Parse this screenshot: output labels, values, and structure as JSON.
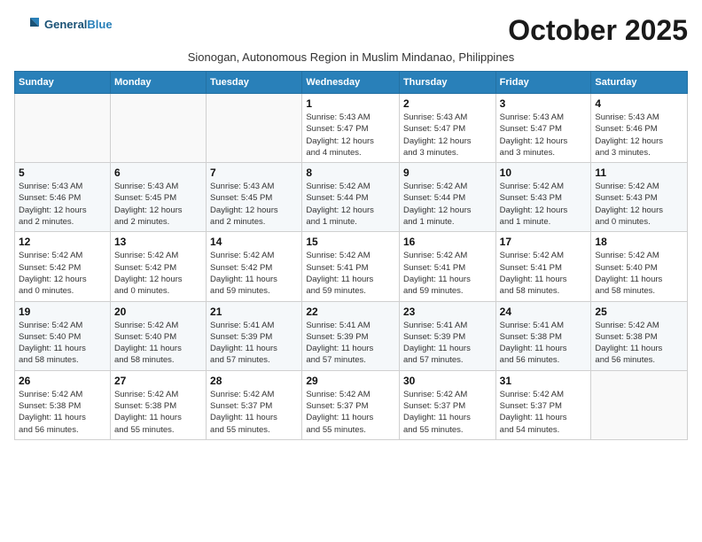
{
  "header": {
    "logo_line1": "General",
    "logo_line2": "Blue",
    "month_title": "October 2025",
    "subtitle": "Sionogan, Autonomous Region in Muslim Mindanao, Philippines"
  },
  "days_of_week": [
    "Sunday",
    "Monday",
    "Tuesday",
    "Wednesday",
    "Thursday",
    "Friday",
    "Saturday"
  ],
  "weeks": [
    [
      {
        "day": "",
        "info": ""
      },
      {
        "day": "",
        "info": ""
      },
      {
        "day": "",
        "info": ""
      },
      {
        "day": "1",
        "info": "Sunrise: 5:43 AM\nSunset: 5:47 PM\nDaylight: 12 hours\nand 4 minutes."
      },
      {
        "day": "2",
        "info": "Sunrise: 5:43 AM\nSunset: 5:47 PM\nDaylight: 12 hours\nand 3 minutes."
      },
      {
        "day": "3",
        "info": "Sunrise: 5:43 AM\nSunset: 5:47 PM\nDaylight: 12 hours\nand 3 minutes."
      },
      {
        "day": "4",
        "info": "Sunrise: 5:43 AM\nSunset: 5:46 PM\nDaylight: 12 hours\nand 3 minutes."
      }
    ],
    [
      {
        "day": "5",
        "info": "Sunrise: 5:43 AM\nSunset: 5:46 PM\nDaylight: 12 hours\nand 2 minutes."
      },
      {
        "day": "6",
        "info": "Sunrise: 5:43 AM\nSunset: 5:45 PM\nDaylight: 12 hours\nand 2 minutes."
      },
      {
        "day": "7",
        "info": "Sunrise: 5:43 AM\nSunset: 5:45 PM\nDaylight: 12 hours\nand 2 minutes."
      },
      {
        "day": "8",
        "info": "Sunrise: 5:42 AM\nSunset: 5:44 PM\nDaylight: 12 hours\nand 1 minute."
      },
      {
        "day": "9",
        "info": "Sunrise: 5:42 AM\nSunset: 5:44 PM\nDaylight: 12 hours\nand 1 minute."
      },
      {
        "day": "10",
        "info": "Sunrise: 5:42 AM\nSunset: 5:43 PM\nDaylight: 12 hours\nand 1 minute."
      },
      {
        "day": "11",
        "info": "Sunrise: 5:42 AM\nSunset: 5:43 PM\nDaylight: 12 hours\nand 0 minutes."
      }
    ],
    [
      {
        "day": "12",
        "info": "Sunrise: 5:42 AM\nSunset: 5:42 PM\nDaylight: 12 hours\nand 0 minutes."
      },
      {
        "day": "13",
        "info": "Sunrise: 5:42 AM\nSunset: 5:42 PM\nDaylight: 12 hours\nand 0 minutes."
      },
      {
        "day": "14",
        "info": "Sunrise: 5:42 AM\nSunset: 5:42 PM\nDaylight: 11 hours\nand 59 minutes."
      },
      {
        "day": "15",
        "info": "Sunrise: 5:42 AM\nSunset: 5:41 PM\nDaylight: 11 hours\nand 59 minutes."
      },
      {
        "day": "16",
        "info": "Sunrise: 5:42 AM\nSunset: 5:41 PM\nDaylight: 11 hours\nand 59 minutes."
      },
      {
        "day": "17",
        "info": "Sunrise: 5:42 AM\nSunset: 5:41 PM\nDaylight: 11 hours\nand 58 minutes."
      },
      {
        "day": "18",
        "info": "Sunrise: 5:42 AM\nSunset: 5:40 PM\nDaylight: 11 hours\nand 58 minutes."
      }
    ],
    [
      {
        "day": "19",
        "info": "Sunrise: 5:42 AM\nSunset: 5:40 PM\nDaylight: 11 hours\nand 58 minutes."
      },
      {
        "day": "20",
        "info": "Sunrise: 5:42 AM\nSunset: 5:40 PM\nDaylight: 11 hours\nand 58 minutes."
      },
      {
        "day": "21",
        "info": "Sunrise: 5:41 AM\nSunset: 5:39 PM\nDaylight: 11 hours\nand 57 minutes."
      },
      {
        "day": "22",
        "info": "Sunrise: 5:41 AM\nSunset: 5:39 PM\nDaylight: 11 hours\nand 57 minutes."
      },
      {
        "day": "23",
        "info": "Sunrise: 5:41 AM\nSunset: 5:39 PM\nDaylight: 11 hours\nand 57 minutes."
      },
      {
        "day": "24",
        "info": "Sunrise: 5:41 AM\nSunset: 5:38 PM\nDaylight: 11 hours\nand 56 minutes."
      },
      {
        "day": "25",
        "info": "Sunrise: 5:42 AM\nSunset: 5:38 PM\nDaylight: 11 hours\nand 56 minutes."
      }
    ],
    [
      {
        "day": "26",
        "info": "Sunrise: 5:42 AM\nSunset: 5:38 PM\nDaylight: 11 hours\nand 56 minutes."
      },
      {
        "day": "27",
        "info": "Sunrise: 5:42 AM\nSunset: 5:38 PM\nDaylight: 11 hours\nand 55 minutes."
      },
      {
        "day": "28",
        "info": "Sunrise: 5:42 AM\nSunset: 5:37 PM\nDaylight: 11 hours\nand 55 minutes."
      },
      {
        "day": "29",
        "info": "Sunrise: 5:42 AM\nSunset: 5:37 PM\nDaylight: 11 hours\nand 55 minutes."
      },
      {
        "day": "30",
        "info": "Sunrise: 5:42 AM\nSunset: 5:37 PM\nDaylight: 11 hours\nand 55 minutes."
      },
      {
        "day": "31",
        "info": "Sunrise: 5:42 AM\nSunset: 5:37 PM\nDaylight: 11 hours\nand 54 minutes."
      },
      {
        "day": "",
        "info": ""
      }
    ]
  ]
}
